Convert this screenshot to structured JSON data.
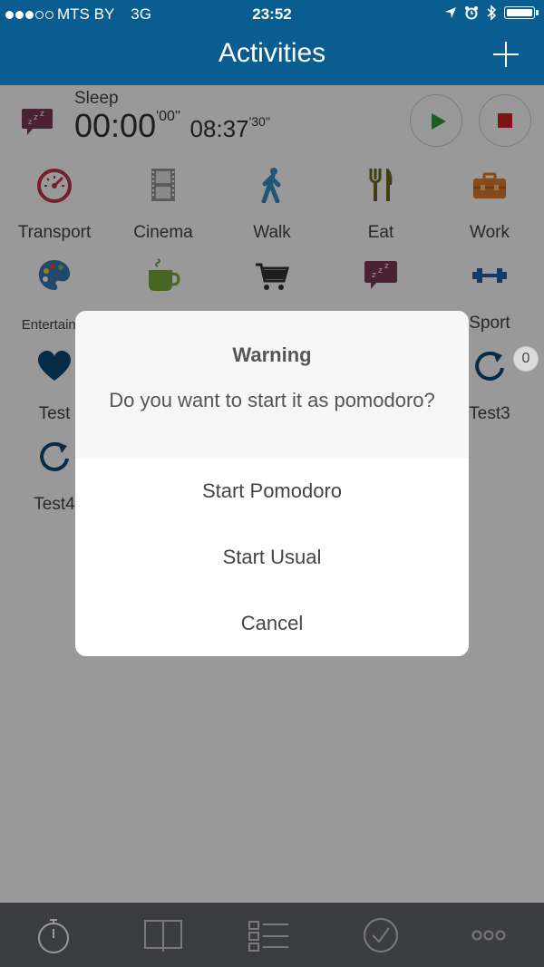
{
  "status_bar": {
    "carrier": "MTS BY",
    "network": "3G",
    "time": "23:52",
    "icons": [
      "location-arrow-icon",
      "alarm-icon",
      "bluetooth-icon",
      "battery-icon"
    ]
  },
  "nav": {
    "title": "Activities",
    "add_icon": "plus-icon"
  },
  "current_activity": {
    "name": "Sleep",
    "elapsed_main": "00:00",
    "elapsed_seconds": "'00''",
    "total_main": "08:37",
    "total_seconds": "'30''",
    "play_icon": "play-icon",
    "stop_icon": "stop-icon"
  },
  "activities": [
    {
      "label": "Transport",
      "icon": "speedometer-icon",
      "color": "#c0344d"
    },
    {
      "label": "Cinema",
      "icon": "film-strip-icon",
      "color": "#8a8a8a"
    },
    {
      "label": "Walk",
      "icon": "walking-person-icon",
      "color": "#3a8fc7"
    },
    {
      "label": "Eat",
      "icon": "fork-knife-icon",
      "color": "#6b6a1f"
    },
    {
      "label": "Work",
      "icon": "briefcase-icon",
      "color": "#e07b2a"
    },
    {
      "label": "Entertainm",
      "icon": "palette-icon",
      "color": "#3a78b7"
    },
    {
      "label": "",
      "icon": "coffee-cup-icon",
      "color": "#7aa83b"
    },
    {
      "label": "",
      "icon": "shopping-cart-icon",
      "color": "#333333"
    },
    {
      "label": "",
      "icon": "sleep-bubble-icon",
      "color": "#7a3b55"
    },
    {
      "label": "Sport",
      "icon": "dumbbell-icon",
      "color": "#1f5ea8"
    },
    {
      "label": "Test",
      "icon": "heart-icon",
      "color": "#0d4a78"
    },
    {
      "label": "Test3",
      "icon": "refresh-icon",
      "color": "#0d4a78"
    },
    {
      "label": "Test4",
      "icon": "refresh-icon",
      "color": "#0d4a78"
    }
  ],
  "badge": "0",
  "dialog": {
    "title": "Warning",
    "message": "Do you want to start it as pomodoro?",
    "options": [
      "Start Pomodoro",
      "Start Usual",
      "Cancel"
    ]
  },
  "tab_bar": {
    "tabs": [
      "stopwatch-icon",
      "book-icon",
      "list-icon",
      "checkmark-icon",
      "more-icon"
    ]
  }
}
